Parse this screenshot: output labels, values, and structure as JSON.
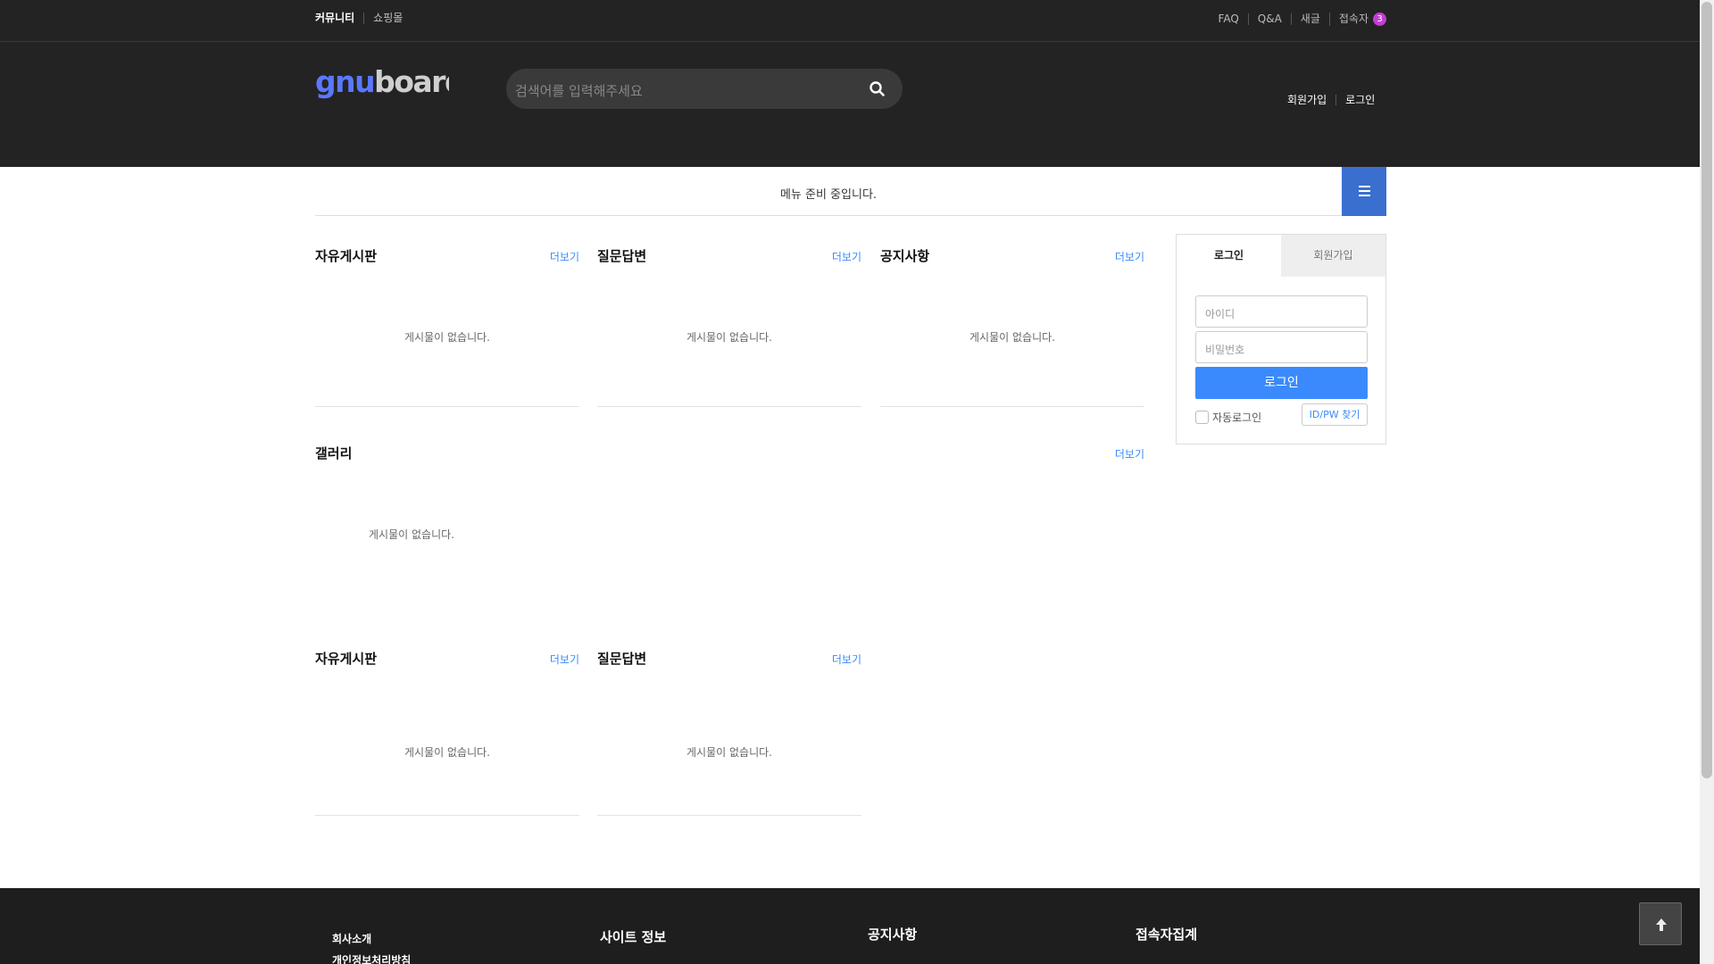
{
  "topbar": {
    "left": [
      "커뮤니티",
      "쇼핑몰"
    ],
    "right": [
      "FAQ",
      "Q&A",
      "새글",
      "접속자"
    ],
    "visitor_count": "3"
  },
  "header": {
    "logo_text": "gnuboard",
    "search_placeholder": "검색어를 입력해주세요",
    "links": [
      "회원가입",
      "로그인"
    ]
  },
  "gnb": {
    "message": "메뉴 준비 중입니다."
  },
  "boards": {
    "row1": [
      {
        "title": "자유게시판",
        "more": "더보기",
        "empty": "게시물이 없습니다."
      },
      {
        "title": "질문답변",
        "more": "더보기",
        "empty": "게시물이 없습니다."
      },
      {
        "title": "공지사항",
        "more": "더보기",
        "empty": "게시물이 없습니다."
      }
    ],
    "gallery": {
      "title": "갤러리",
      "more": "더보기",
      "empty": "게시물이 없습니다."
    },
    "row3": [
      {
        "title": "자유게시판",
        "more": "더보기",
        "empty": "게시물이 없습니다."
      },
      {
        "title": "질문답변",
        "more": "더보기",
        "empty": "게시물이 없습니다."
      }
    ]
  },
  "login": {
    "tab_login": "로그인",
    "tab_join": "회원가입",
    "id_placeholder": "아이디",
    "pw_placeholder": "비밀번호",
    "submit": "로그인",
    "auto_login": "자동로그인",
    "find": "ID/PW 찾기"
  },
  "footer": {
    "links": [
      "회사소개",
      "개인정보처리방침"
    ],
    "site_info": "사이트 정보",
    "notice": "공지사항",
    "stats": "접속자집계"
  },
  "colors": {
    "accent": "#3a8afd",
    "menu_button": "#3a6fd0",
    "badge": "#c23fd0",
    "dark": "#232323"
  }
}
